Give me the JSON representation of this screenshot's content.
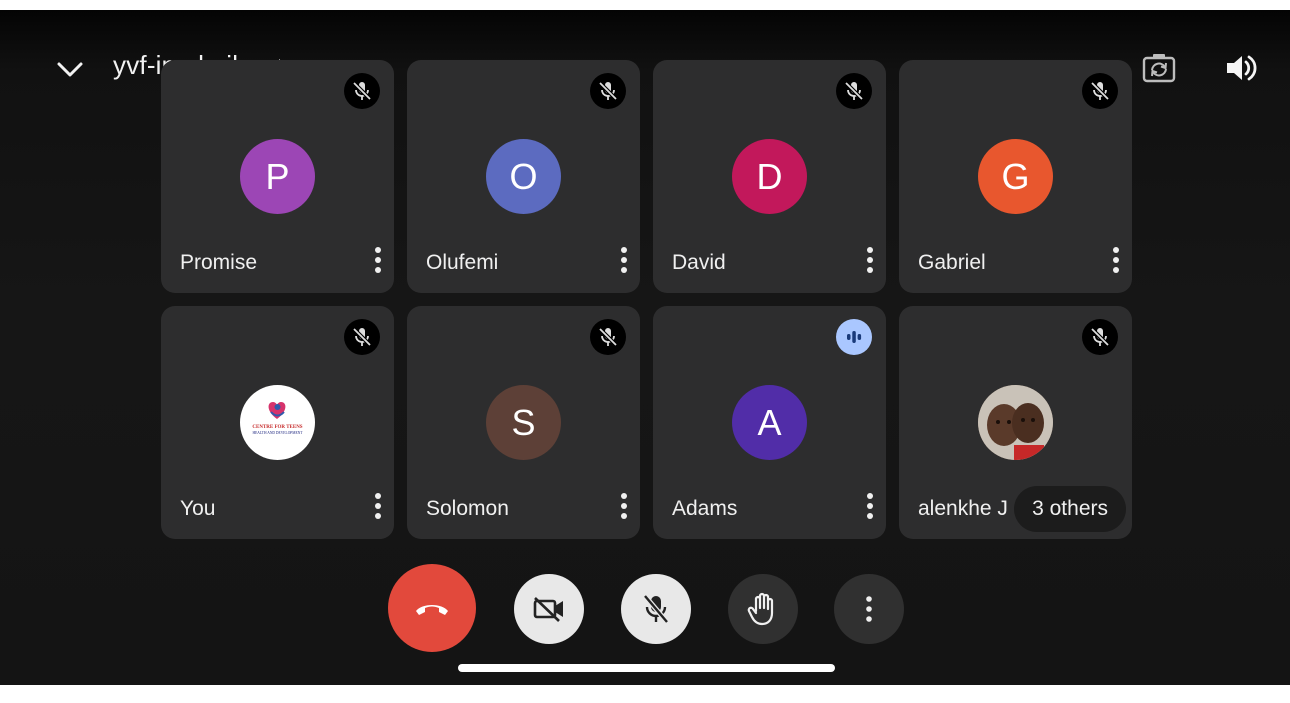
{
  "header": {
    "meeting_code": "yvf-ipcd-zik"
  },
  "participants": [
    {
      "name": "Promise",
      "initial": "P",
      "avatar_color": "#9c46b5",
      "muted": true
    },
    {
      "name": "Olufemi",
      "initial": "O",
      "avatar_color": "#5c6bc0",
      "muted": true
    },
    {
      "name": "David",
      "initial": "D",
      "avatar_color": "#c2185b",
      "muted": true
    },
    {
      "name": "Gabriel",
      "initial": "G",
      "avatar_color": "#e8572e",
      "muted": true
    },
    {
      "name": "You",
      "initial": "",
      "avatar_type": "logo",
      "muted": true,
      "logo_text": "CENTRE FOR TEENS",
      "logo_subtext": "HEALTH AND DEVELOPMENT"
    },
    {
      "name": "Solomon",
      "initial": "S",
      "avatar_color": "#5d4037",
      "muted": true
    },
    {
      "name": "Adams",
      "initial": "A",
      "avatar_color": "#512da8",
      "muted": false,
      "speaking": true
    },
    {
      "name": "alenkhe J",
      "initial": "",
      "avatar_type": "photo",
      "muted": true,
      "others_label": "3 others"
    }
  ],
  "controls": {
    "end_call_color": "#e2493c",
    "camera_off_bg": "#e8e8e8",
    "mic_off_bg": "#e8e8e8",
    "raise_hand_bg": "#303030",
    "more_bg": "#303030"
  },
  "icons": {
    "collapse": "chevron-down-icon",
    "switch_camera": "switch-camera-icon",
    "audio": "speaker-icon"
  }
}
